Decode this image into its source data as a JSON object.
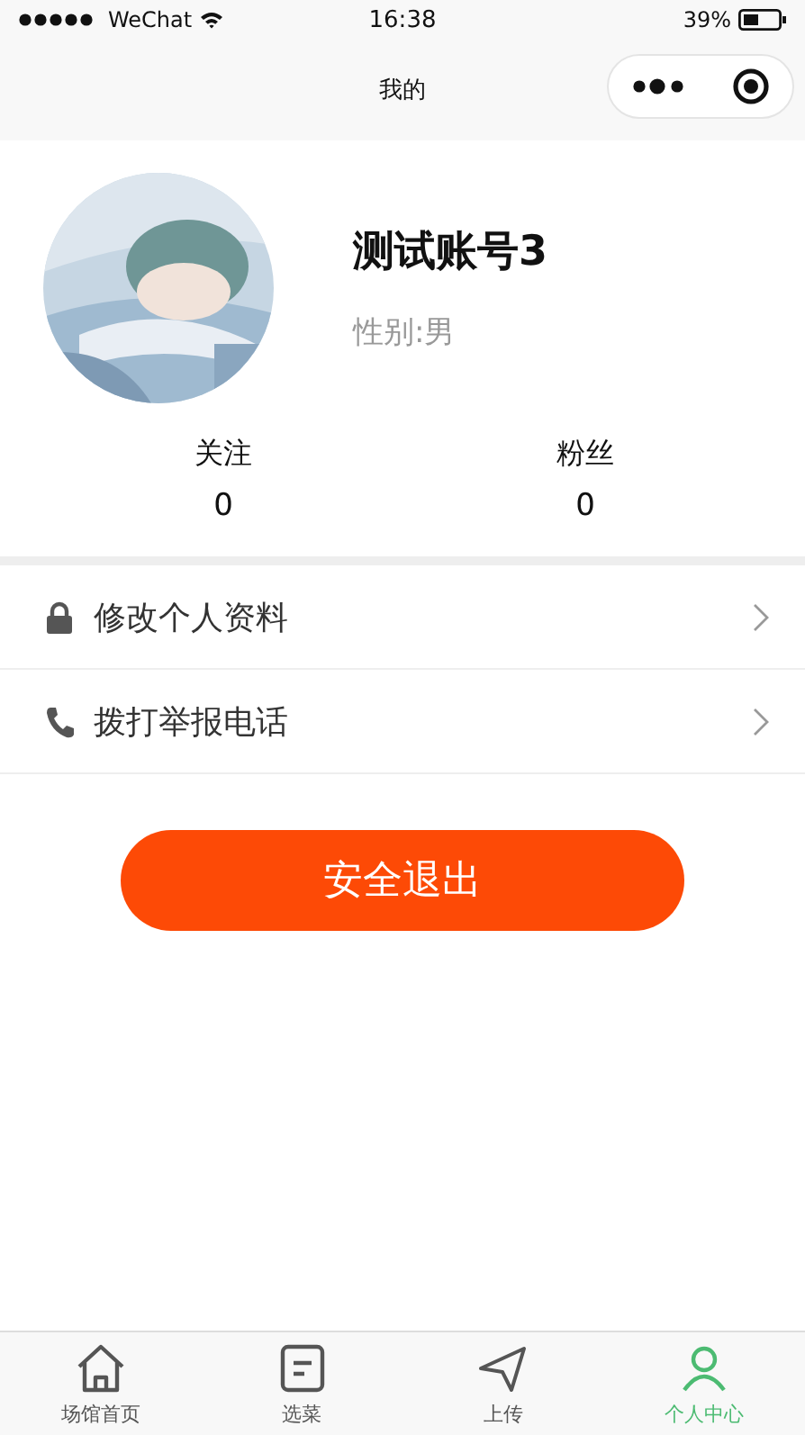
{
  "status_bar": {
    "carrier": "WeChat",
    "time": "16:38",
    "battery": "39%"
  },
  "nav": {
    "title": "我的"
  },
  "profile": {
    "name": "测试账号3",
    "gender": "性别:男"
  },
  "stats": [
    {
      "label": "关注",
      "value": "0"
    },
    {
      "label": "粉丝",
      "value": "0"
    }
  ],
  "menu": [
    {
      "kind": "lock",
      "label": "修改个人资料"
    },
    {
      "kind": "phone",
      "label": "拨打举报电话"
    }
  ],
  "logout_button": "安全退出",
  "tab_bar": [
    {
      "kind": "home",
      "label": "场馆首页",
      "selected": false
    },
    {
      "kind": "list",
      "label": "选菜",
      "selected": false
    },
    {
      "kind": "send",
      "label": "上传",
      "selected": false
    },
    {
      "kind": "user",
      "label": "个人中心",
      "selected": true
    }
  ]
}
